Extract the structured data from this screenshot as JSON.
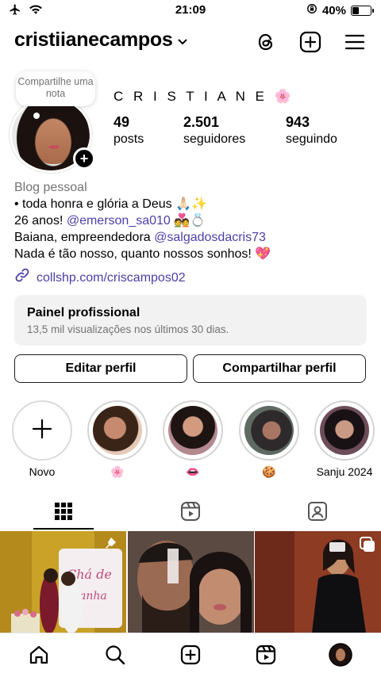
{
  "status_bar": {
    "time": "21:09",
    "battery_text": "40%",
    "battery_level": 0.4,
    "icons": [
      "airplane-icon",
      "wifi-icon",
      "orientation-lock-icon",
      "battery-icon"
    ]
  },
  "header": {
    "username": "cristiianecampos",
    "icons": [
      "threads-icon",
      "create-icon",
      "menu-icon"
    ]
  },
  "profile": {
    "note_text": "Compartilhe uma nota",
    "display_name": "C R I S T I A N E 🌸",
    "stats": [
      {
        "value": "49",
        "label": "posts"
      },
      {
        "value": "2.501",
        "label": "seguidores"
      },
      {
        "value": "943",
        "label": "seguindo"
      }
    ]
  },
  "bio": {
    "category": "Blog pessoal",
    "line1": "• toda honra e glória a Deus 🙏🏻✨",
    "line2_prefix": "26 anos! ",
    "line2_mention": "@emerson_sa010",
    "line2_suffix": " 💑💍",
    "line3_prefix": "Baiana, empreendedora ",
    "line3_mention": "@salgadosdacris73",
    "line4": "Nada é tão nosso, quanto nossos sonhos! 💖",
    "link": "collshp.com/criscampos02"
  },
  "pro_panel": {
    "title": "Painel profissional",
    "subtitle": "13,5 mil visualizações nos últimos 30 dias."
  },
  "buttons": {
    "edit": "Editar perfil",
    "share": "Compartilhar perfil"
  },
  "highlights": [
    {
      "label": "Novo"
    },
    {
      "label": "🌸"
    },
    {
      "label": "👄"
    },
    {
      "label": "🍪"
    },
    {
      "label": "Sanju 2024"
    }
  ],
  "tabs": [
    "grid-icon",
    "reels-icon",
    "tagged-icon"
  ],
  "bottom_nav": [
    "home-icon",
    "search-icon",
    "create-icon",
    "reels-icon",
    "profile-avatar"
  ],
  "colors": {
    "link": "#4b3fa8",
    "secondary_text": "#737373",
    "panel_bg": "#f2f2f2"
  }
}
